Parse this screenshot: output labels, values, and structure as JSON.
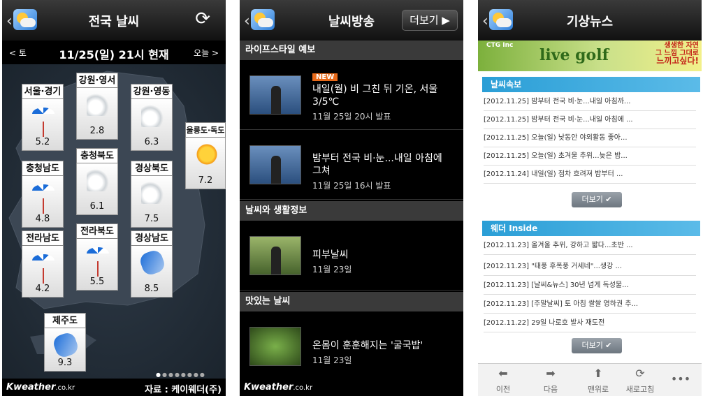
{
  "screen1": {
    "title": "전국 날씨",
    "prev": "< 토",
    "current": "11/25(일) 21시 현재",
    "next": "오늘 >",
    "regions": [
      {
        "name": "서울·경기",
        "temp": "5.2",
        "icon": "rain-umbrella-icon"
      },
      {
        "name": "강원·영서",
        "temp": "2.8",
        "icon": "cloud-icon"
      },
      {
        "name": "강원·영동",
        "temp": "6.3",
        "icon": "cloud-icon"
      },
      {
        "name": "울릉도·독도",
        "temp": "7.2",
        "icon": "sun-cloud-icon"
      },
      {
        "name": "충청남도",
        "temp": "4.8",
        "icon": "rain-umbrella-icon"
      },
      {
        "name": "충청북도",
        "temp": "6.1",
        "icon": "cloud-icon"
      },
      {
        "name": "경상북도",
        "temp": "7.5",
        "icon": "cloud-icon"
      },
      {
        "name": "전라남도",
        "temp": "4.2",
        "icon": "rain-umbrella-icon"
      },
      {
        "name": "전라북도",
        "temp": "5.5",
        "icon": "rain-umbrella-icon"
      },
      {
        "name": "경상남도",
        "temp": "8.5",
        "icon": "closed-umbrella-icon"
      },
      {
        "name": "제주도",
        "temp": "9.3",
        "icon": "closed-umbrella-icon"
      }
    ],
    "logo": "Kweather",
    "logo_suffix": ".co.kr",
    "source": "자료 : 케이웨더(주)"
  },
  "screen2": {
    "title": "날씨방송",
    "more": "더보기 ▶",
    "sections": [
      {
        "header": "라이프스타일 예보"
      },
      {
        "header": "날씨와 생활정보"
      },
      {
        "header": "맛있는 날씨"
      }
    ],
    "items": [
      {
        "badge": "NEW",
        "title": "내일(월) 비 그친 뒤 기온, 서울 3/5℃",
        "date": "11월 25일 20시 발표"
      },
      {
        "title": "밤부터 전국 비·눈...내일 아침에 그쳐",
        "date": "11월 25일 16시 발표"
      },
      {
        "title": "피부날씨",
        "date": "11월 23일"
      },
      {
        "title": "온몸이 훈훈해지는 '굴국밥'",
        "date": "11월 23일"
      }
    ],
    "logo": "Kweather",
    "logo_suffix": ".co.kr"
  },
  "screen3": {
    "title": "기상뉴스",
    "ad": {
      "brand": "CTG Inc",
      "product": "live golf",
      "line1": "생생한 자연",
      "line2": "그 느낌 그대로",
      "line3": "느끼고싶다!"
    },
    "news_header": "날씨속보",
    "news": [
      "[2012.11.25] 밤부터 전국 비·눈...내일 아침까...",
      "[2012.11.25] 밤부터 전국 비·눈...내일 아침에 ...",
      "[2012.11.25] 오늘(일) 낮동안 야외활동 좋아...",
      "[2012.11.25] 오늘(일) 초겨울 추위...늦은 밤...",
      "[2012.11.24] 내일(일) 점차 흐려져 밤부터 ..."
    ],
    "more": "더보기 ✔",
    "inside_header": "웨더 Inside",
    "inside": [
      "[2012.11.23] 올겨울 추위, 강하고 짧다...초반 ...",
      "[2012.11.23] \"태풍 후폭풍 거세네\"...생강 ...",
      "[2012.11.23] [날씨&뉴스] 30년 넘게 독성물...",
      "[2012.11.23] [주말날씨] 토 아침 쌀쌀 영하권 추...",
      "[2012.11.22] 29일 나로호 발사 재도전"
    ],
    "toolbar": {
      "prev": "이전",
      "next": "다음",
      "top": "맨위로",
      "reload": "새로고침"
    }
  }
}
